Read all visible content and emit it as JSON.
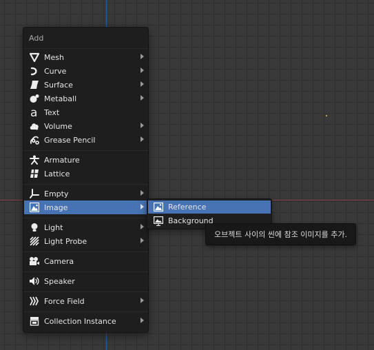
{
  "viewport": {
    "x_axis_color": "#8a3a42",
    "y_axis_color": "#2e5f9c",
    "grid_color": "#2f2f2f",
    "background_color": "#393939"
  },
  "menu": {
    "title": "Add",
    "items": [
      {
        "label": "Mesh",
        "icon": "mesh-icon",
        "submenu": true
      },
      {
        "label": "Curve",
        "icon": "curve-icon",
        "submenu": true
      },
      {
        "label": "Surface",
        "icon": "surface-icon",
        "submenu": true
      },
      {
        "label": "Metaball",
        "icon": "metaball-icon",
        "submenu": true
      },
      {
        "label": "Text",
        "icon": "text-icon",
        "submenu": false
      },
      {
        "label": "Volume",
        "icon": "volume-icon",
        "submenu": true
      },
      {
        "label": "Grease Pencil",
        "icon": "grease-pencil-icon",
        "submenu": true
      },
      {
        "label": "Armature",
        "icon": "armature-icon",
        "submenu": false
      },
      {
        "label": "Lattice",
        "icon": "lattice-icon",
        "submenu": false
      },
      {
        "label": "Empty",
        "icon": "empty-icon",
        "submenu": true
      },
      {
        "label": "Image",
        "icon": "image-icon",
        "submenu": true,
        "active": true
      },
      {
        "label": "Light",
        "icon": "light-icon",
        "submenu": true
      },
      {
        "label": "Light Probe",
        "icon": "light-probe-icon",
        "submenu": true
      },
      {
        "label": "Camera",
        "icon": "camera-icon",
        "submenu": false
      },
      {
        "label": "Speaker",
        "icon": "speaker-icon",
        "submenu": false
      },
      {
        "label": "Force Field",
        "icon": "force-field-icon",
        "submenu": true
      },
      {
        "label": "Collection Instance",
        "icon": "collection-instance-icon",
        "submenu": true
      }
    ]
  },
  "submenu": {
    "items": [
      {
        "label": "Reference",
        "icon": "image-reference-icon",
        "active": true
      },
      {
        "label": "Background",
        "icon": "image-background-icon",
        "active": false
      }
    ]
  },
  "tooltip": {
    "text": "오브젝트 사이의 씬에 참조 이미지를 추가."
  },
  "colors": {
    "menu_bg": "#1e1e1e",
    "highlight": "#4772b3",
    "text": "#e6e6e6",
    "title_text": "#a9a9a9"
  }
}
